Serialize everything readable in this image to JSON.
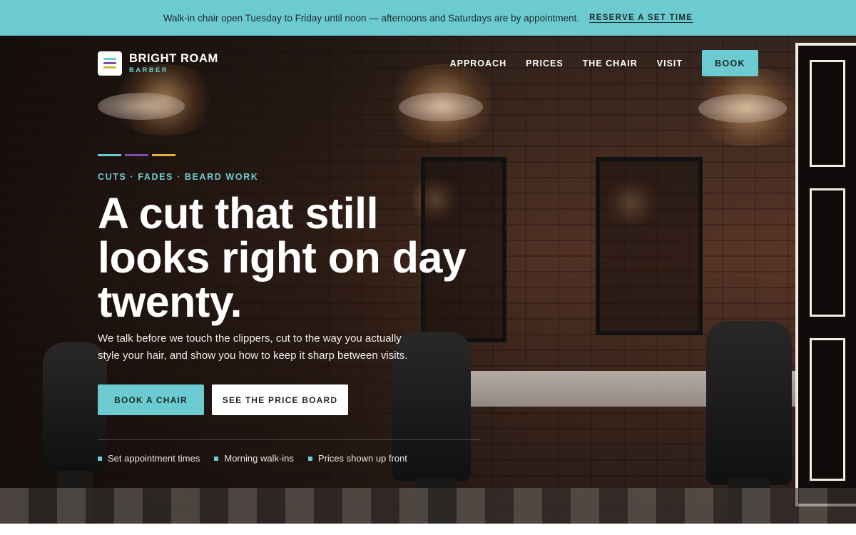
{
  "announcement": {
    "text": "Walk-in chair open Tuesday to Friday until noon — afternoons and Saturdays are by appointment.",
    "link": "RESERVE A SET TIME"
  },
  "brand": {
    "name": "BRIGHT ROAM",
    "sub": "BARBER",
    "logo_colors": [
      "#6ccbd0",
      "#7a4fb0",
      "#e0b13a"
    ]
  },
  "nav": {
    "links": [
      "APPROACH",
      "PRICES",
      "THE CHAIR",
      "VISIT"
    ],
    "book": "BOOK"
  },
  "hero": {
    "stripe_colors": [
      "#6ccbd0",
      "#7a4fb0",
      "#e0b13a"
    ],
    "eyebrow": "CUTS · FADES · BEARD WORK",
    "headline": "A cut that still looks right on day twenty.",
    "lede": "We talk before we touch the clippers, cut to the way you actually style your hair, and show you how to keep it sharp between visits.",
    "cta_primary": "BOOK A CHAIR",
    "cta_secondary": "SEE THE PRICE BOARD",
    "features": [
      "Set appointment times",
      "Morning walk-ins",
      "Prices shown up front"
    ]
  },
  "colors": {
    "accent": "#6ccbd0",
    "purple": "#7a4fb0",
    "gold": "#e0b13a"
  }
}
